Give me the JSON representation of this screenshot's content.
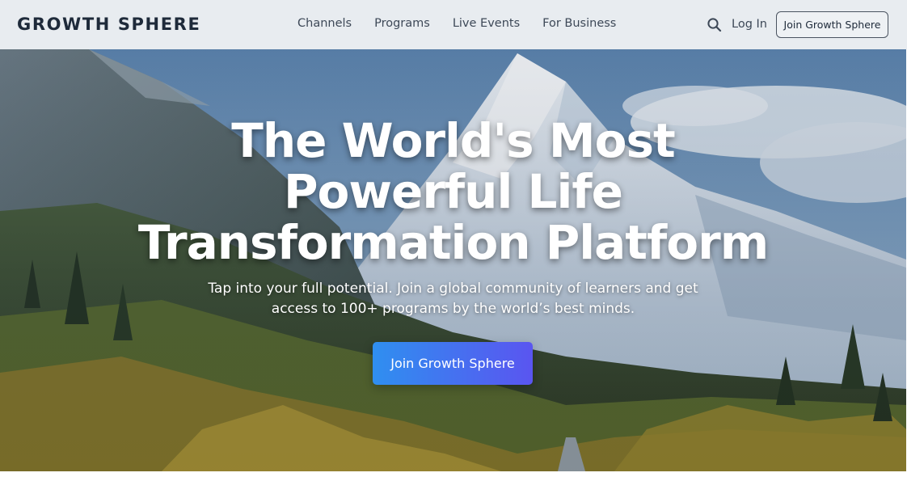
{
  "header": {
    "logo": "GROWTH SPHERE",
    "nav": [
      "Channels",
      "Programs",
      "Live Events",
      "For Business"
    ],
    "login": "Log In",
    "join_button": "Join Growth Sphere"
  },
  "hero": {
    "headline_lines": [
      "The World's Most",
      "Powerful Life",
      "Transformation Platform"
    ],
    "subtext_lines": [
      "Tap into your full potential. Join a global community of learners and get",
      "access to 100+ programs by the world’s best minds."
    ],
    "cta": "Join Growth Sphere"
  },
  "colors": {
    "nav_bg": "#e8ecf0",
    "cta_gradient_start": "#2f8ff0",
    "cta_gradient_end": "#5a55f0"
  },
  "icons": {
    "search": "search-icon"
  }
}
